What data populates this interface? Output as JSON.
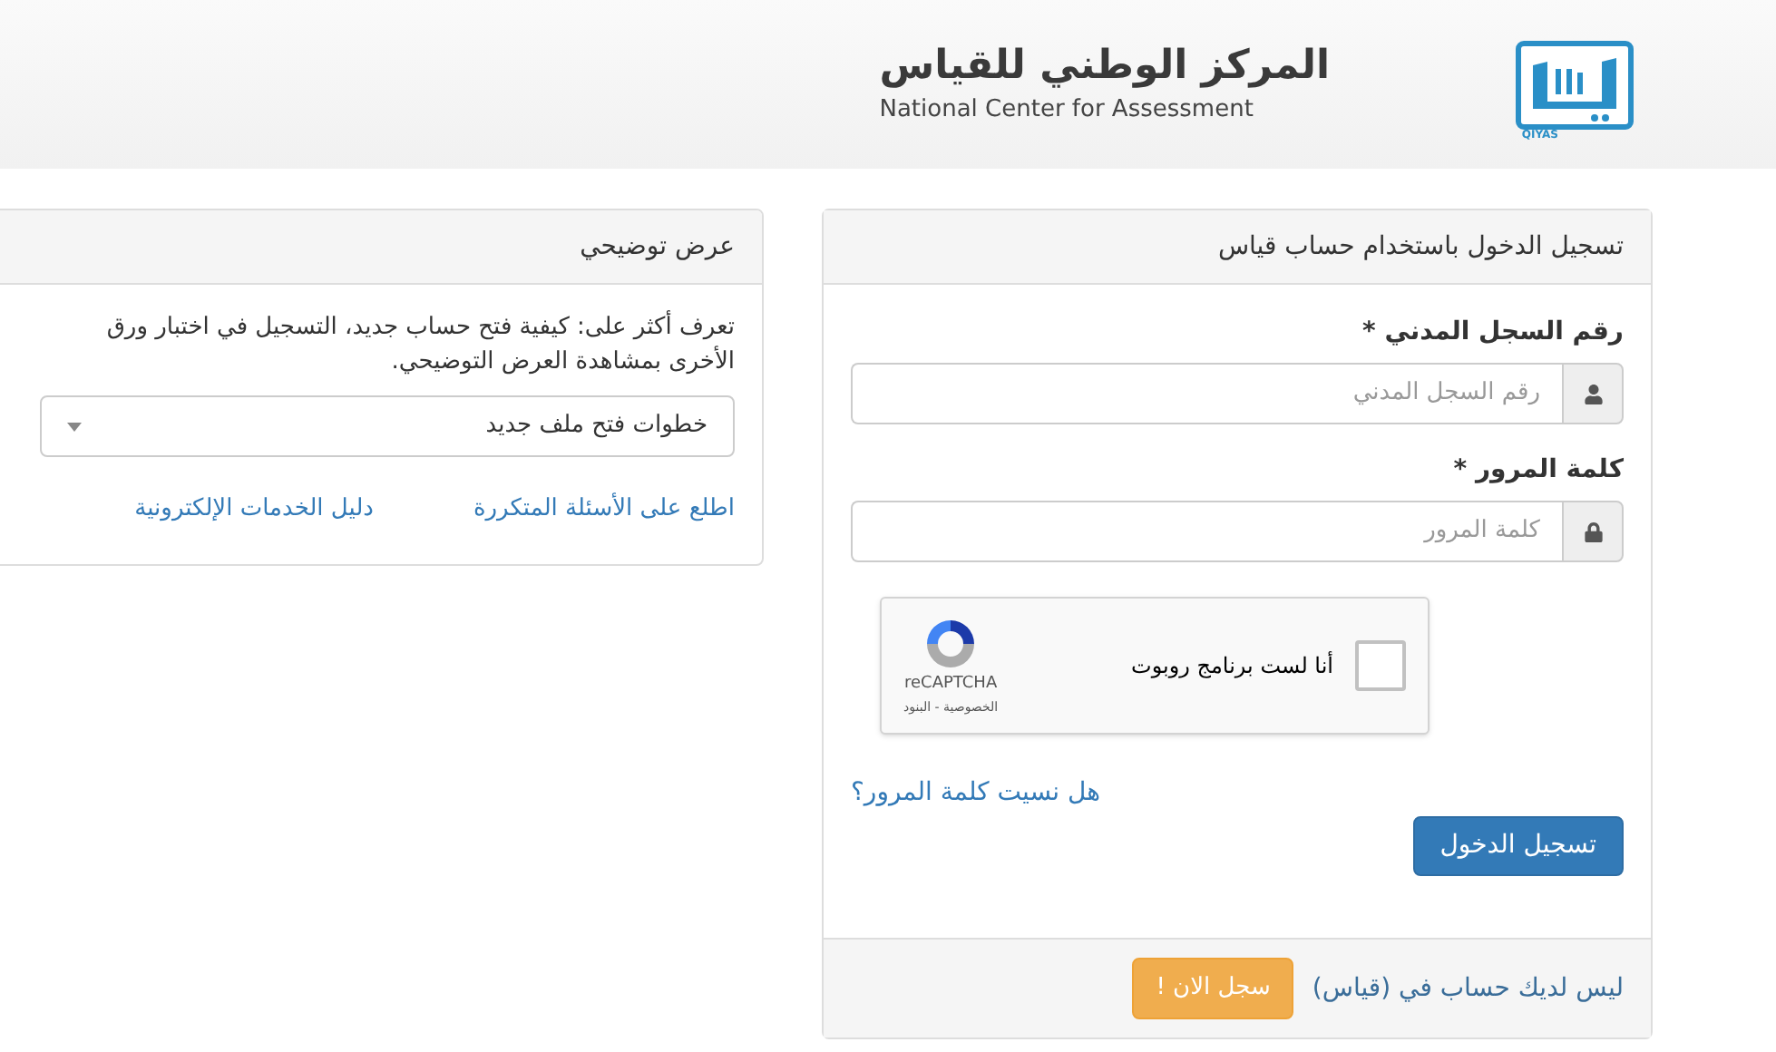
{
  "header": {
    "title_ar": "المركز الوطني للقياس",
    "title_en": "National Center for Assessment",
    "logo_text": "QIYAS"
  },
  "login_panel": {
    "title": "تسجيل الدخول باستخدام حساب قياس",
    "fields": [
      {
        "label": "رقم السجل المدني *",
        "placeholder": "رقم السجل المدني",
        "kind": "user"
      },
      {
        "label": "كلمة المرور *",
        "placeholder": "كلمة المرور",
        "kind": "lock"
      }
    ],
    "captcha": {
      "label": "أنا لست برنامج روبوت",
      "checked": false,
      "brand": "reCAPTCHA",
      "links": "الخصوصية - البنود"
    },
    "forgot_link": "هل نسيت كلمة المرور؟",
    "submit": "تسجيل الدخول",
    "footer": {
      "text": "ليس لديك حساب في (قياس)",
      "button": "سجل الان !"
    }
  },
  "demo_panel": {
    "title": "عرض توضيحي",
    "description_lines": [
      "تعرف أكثر على: كيفية فتح حساب جديد، التسجيل في اختبار ورق",
      "الأخرى بمشاهدة العرض التوضيحي."
    ],
    "select": {
      "value": "خطوات فتح ملف جديد"
    },
    "links": [
      "اطلع على الأسئلة المتكررة",
      "دليل الخدمات الإلكترونية"
    ]
  }
}
